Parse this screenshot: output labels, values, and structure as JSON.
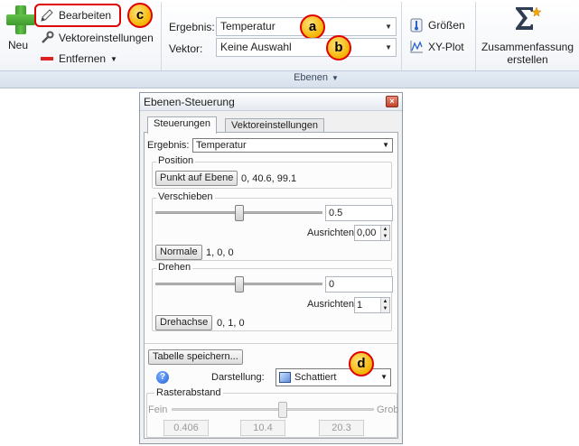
{
  "ribbon": {
    "new_label": "Neu",
    "edit_label": "Bearbeiten",
    "vector_settings_label": "Vektoreinstellungen",
    "remove_label": "Entfernen",
    "result_label": "Ergebnis:",
    "result_value": "Temperatur",
    "vector_label": "Vektor:",
    "vector_value": "Keine Auswahl",
    "sizes_label": "Größen",
    "xy_plot_label": "XY-Plot",
    "summary_label_line1": "Zusammenfassung",
    "summary_label_line2": "erstellen",
    "group_label": "Ebenen"
  },
  "callouts": {
    "a": "a",
    "b": "b",
    "c": "c",
    "d": "d"
  },
  "dialog": {
    "title": "Ebenen-Steuerung",
    "close_glyph": "×",
    "tabs": [
      {
        "label": "Steuerungen",
        "active": true
      },
      {
        "label": "Vektoreinstellungen",
        "active": false
      }
    ],
    "result_label": "Ergebnis:",
    "result_value": "Temperatur",
    "position": {
      "title": "Position",
      "button": "Punkt auf Ebene",
      "value": "0, 40.6, 99.1"
    },
    "shift": {
      "title": "Verschieben",
      "slider_fraction": 0.5,
      "value": "0.5",
      "align_label": "Ausrichten",
      "align_value": "0,00",
      "normal_button": "Normale",
      "normal_value": "1, 0, 0"
    },
    "rotate": {
      "title": "Drehen",
      "slider_fraction": 0.5,
      "value": "0",
      "align_label": "Ausrichten",
      "align_value": "1",
      "axis_button": "Drehachse",
      "axis_value": "0, 1, 0"
    },
    "save_table_button": "Tabelle speichern...",
    "display_label": "Darstellung:",
    "display_value": "Schattiert",
    "grid": {
      "title": "Rasterabstand",
      "fine_label": "Fein",
      "coarse_label": "Grob",
      "slider_fraction": 0.55,
      "values": [
        "0.406",
        "10.4",
        "20.3"
      ]
    }
  }
}
